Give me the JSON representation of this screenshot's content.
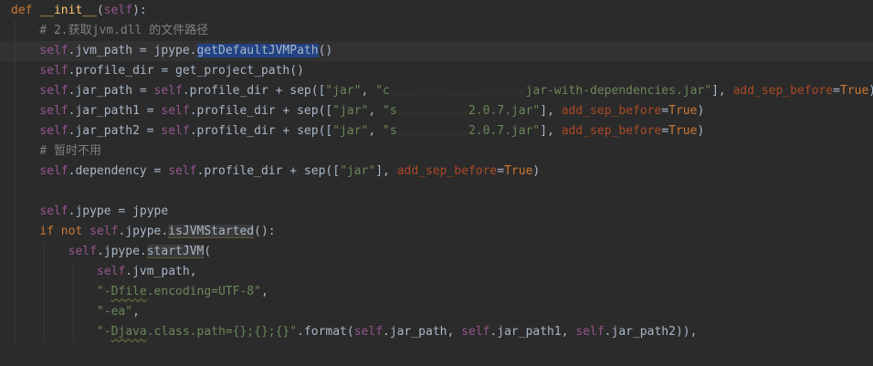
{
  "editor": {
    "lines": {
      "l1": {
        "kw_def": "def",
        "name": "__init__",
        "open": "(",
        "self": "self",
        "close": "):"
      },
      "l2": {
        "comment": "# 2.获取jvm.dll 的文件路径"
      },
      "l3": {
        "self": "self",
        "a": ".jvm_path = jpype.",
        "call": "getDefaultJVMPath",
        "b": "()"
      },
      "l4": {
        "self": "self",
        "a": ".profile_dir = get_project_path()"
      },
      "l5": {
        "self": "self",
        "a": ".jar_path = ",
        "self2": "self",
        "b": ".profile_dir + sep([",
        "s1": "\"jar\"",
        "c": ", ",
        "s2a": "\"c",
        "blur": "...................",
        "s2b": "jar-with-dependencies.jar\"",
        "d": "], ",
        "param": "add_sep_before",
        "e": "=",
        "kw": "True",
        "f": ")"
      },
      "l6": {
        "self": "self",
        "a": ".jar_path1 = ",
        "self2": "self",
        "b": ".profile_dir + sep([",
        "s1": "\"jar\"",
        "c": ", ",
        "s2a": "\"s",
        "blur": "..........",
        "s2b": "2.0.7.jar\"",
        "d": "], ",
        "param": "add_sep_before",
        "e": "=",
        "kw": "True",
        "f": ")"
      },
      "l7": {
        "self": "self",
        "a": ".jar_path2 = ",
        "self2": "self",
        "b": ".profile_dir + sep([",
        "s1": "\"jar\"",
        "c": ", ",
        "s2a": "\"s",
        "blur": "..........",
        "s2b": "2.0.7.jar\"",
        "d": "], ",
        "param": "add_sep_before",
        "e": "=",
        "kw": "True",
        "f": ")"
      },
      "l8": {
        "comment": "# 暂时不用"
      },
      "l9": {
        "self": "self",
        "a": ".dependency = ",
        "self2": "self",
        "b": ".profile_dir + sep([",
        "s1": "\"jar\"",
        "d": "], ",
        "param": "add_sep_before",
        "e": "=",
        "kw": "True",
        "f": ")"
      },
      "l11": {
        "self": "self",
        "a": ".jpype = jpype"
      },
      "l12": {
        "kw_if": "if",
        "kw_not": "not",
        "self": "self",
        "a": ".jpype.",
        "call": "isJVMStarted",
        "b": "():"
      },
      "l13": {
        "self": "self",
        "a": ".jpype.",
        "call": "startJVM",
        "b": "("
      },
      "l14": {
        "self": "self",
        "a": ".jvm_path,"
      },
      "l15": {
        "s_a": "\"-",
        "s_w": "Dfile",
        "s_b": ".encoding=UTF-8\"",
        "c": ","
      },
      "l16": {
        "s": "\"-ea\"",
        "c": ","
      },
      "l17": {
        "s_a": "\"-",
        "s_w": "Djava",
        "s_b": ".class.path={};{};{}\"",
        "a": ".format(",
        "self": "self",
        "b": ".jar_path, ",
        "self2": "self",
        "c": ".jar_path1, ",
        "self3": "self",
        "d": ".jar_path2)),"
      }
    }
  }
}
